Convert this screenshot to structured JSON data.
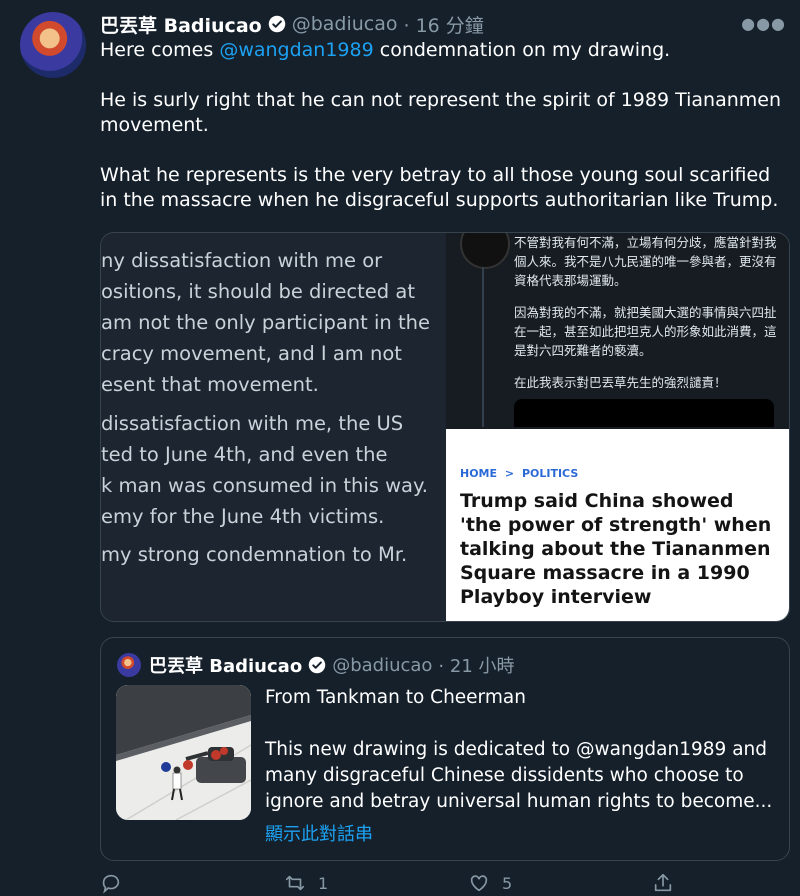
{
  "tweet": {
    "author_name": "巴丟草 Badiucao",
    "handle": "@badiucao",
    "time": "· 16 分鐘",
    "line1_prefix": "Here comes ",
    "line1_mention": "@wangdan1989",
    "line1_suffix": " condemnation on my drawing.",
    "para2": "He is surly right that he can not represent the spirit of 1989 Tiananmen movement.",
    "para3": "What he represents is the very betray to all those young soul scarified in the massacre when he disgraceful supports authoritarian like Trump."
  },
  "media": {
    "left_lines": [
      "ny dissatisfaction with me or",
      "ositions, it should be directed at",
      "am not the only participant in the",
      "cracy movement, and I am not",
      "esent that movement.",
      "dissatisfaction with me, the US",
      "ted to June 4th, and even the",
      "k man was consumed in this way.",
      "emy for the June 4th victims.",
      "my strong condemnation to Mr."
    ],
    "cjk_para1": "不管對我有何不滿，立場有何分歧，應當針對我個人來。我不是八九民運的唯一參與者，更沒有資格代表那場運動。",
    "cjk_para2": "因為對我的不滿，就把美國大選的事情與六四扯在一起，甚至如此把坦克人的形象如此消費，這是對六四死難者的褻瀆。",
    "cjk_para3": "在此我表示對巴丟草先生的強烈譴責！",
    "article_crumb_home": "HOME",
    "article_crumb_sep": ">",
    "article_crumb_section": "POLITICS",
    "article_headline": "Trump said China showed 'the power of strength' when talking about the Tiananmen Square massacre in a 1990 Playboy interview"
  },
  "quote": {
    "author_name": "巴丟草 Badiucao",
    "handle": "@badiucao",
    "time": "· 21 小時",
    "title": "From Tankman to Cheerman",
    "body": "This new drawing is dedicated to @wangdan1989 and many disgraceful Chinese dissidents who choose to ignore and betray universal human rights to become...",
    "show_thread": "顯示此對話串"
  },
  "actions": {
    "reply_count": "",
    "retweet_count": "1",
    "like_count": "5"
  },
  "colors": {
    "background": "#15202b",
    "accent": "#1da1f2",
    "muted": "#8899a6",
    "border": "#38444d"
  },
  "icons": [
    "verified-badge-icon",
    "more-icon",
    "reply-icon",
    "retweet-icon",
    "like-icon",
    "share-icon"
  ]
}
